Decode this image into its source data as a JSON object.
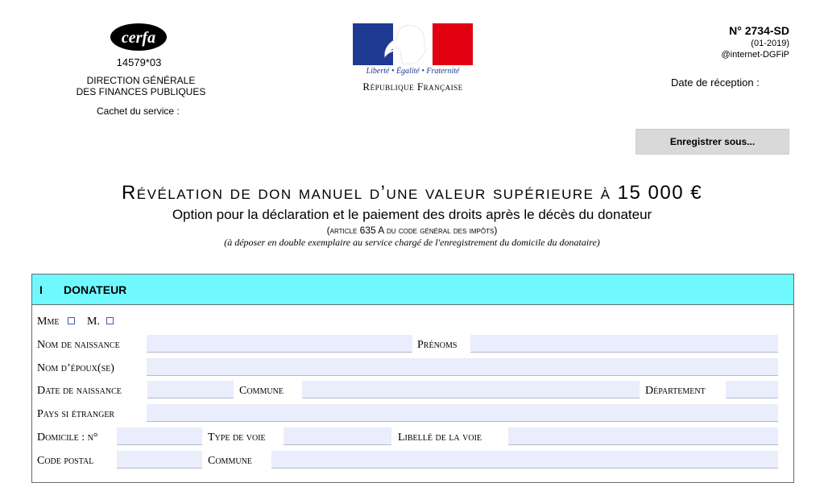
{
  "header_left": {
    "logo_text": "cerfa",
    "form_code": "14579*03",
    "org_line1": "DIRECTION GÉNÉRALE",
    "org_line2": "DES FINANCES PUBLIQUES",
    "stamp_label": "Cachet du service :"
  },
  "header_center": {
    "motto": "Liberté • Égalité • Fraternité",
    "republic": "République Française"
  },
  "header_right": {
    "form_number": "N° 2734-SD",
    "form_date": "(01-2019)",
    "source": "@internet-DGFiP",
    "reception_label": "Date de réception :"
  },
  "save_button": {
    "label": "Enregistrer sous..."
  },
  "title": {
    "main": "Révélation de don manuel d’une valeur supérieure à 15 000 €",
    "subtitle": "Option pour la déclaration et le paiement des droits après le décès du donateur",
    "article": "(article 635 A du code général des impôts)",
    "deposit": "(à déposer en double exemplaire au service chargé de l'enregistrement du domicile du donataire)"
  },
  "section": {
    "number": "I",
    "title": "DONATEUR",
    "labels": {
      "mme": "Mme",
      "m": "M.",
      "birth_name": "Nom de naissance",
      "first_names": "Prénoms",
      "spouse_name": "Nom d’époux(se)",
      "birth_date": "Date de naissance",
      "commune": "Commune",
      "department": "Département",
      "country": "Pays si étranger",
      "domicile_no": "Domicile : n°",
      "street_type": "Type de voie",
      "street_name": "Libellé de la voie",
      "postal_code": "Code postal",
      "commune2": "Commune"
    }
  },
  "colors": {
    "section_header": "#6ff9ff",
    "field_bg": "#eaedfb",
    "button_bg": "#d9d9d9",
    "rf_blue": "#1f3a93",
    "rf_red": "#e1000f"
  }
}
